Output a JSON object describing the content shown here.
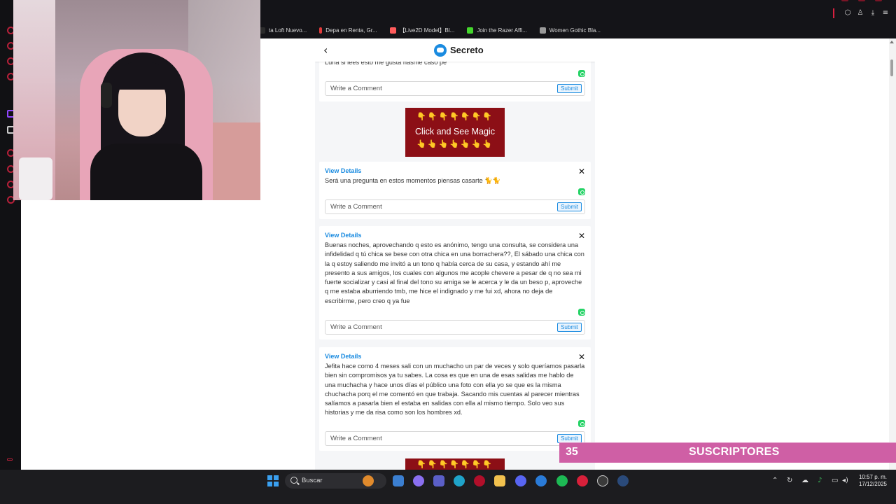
{
  "browser": {
    "bookmarks": [
      {
        "label": "ta Loft Nuevo...",
        "color": "#2b2b2b"
      },
      {
        "label": "Depa en Renta, Gr...",
        "color": "#e23b3b"
      },
      {
        "label": "【Live2D Model】Bl...",
        "color": "#ff5b5b"
      },
      {
        "label": "Join the Razer Affi...",
        "color": "#44d62c"
      },
      {
        "label": "Women Gothic Bla...",
        "color": "#9a9a9a"
      }
    ]
  },
  "page": {
    "title": "Secreto",
    "back_icon": "chevron-left-icon",
    "brand_color": "#1a8be0",
    "partial_top_message": "Luna si lees esto me gusta hasme caso pe",
    "comment_placeholder": "Write a Comment",
    "submit_label": "Submit",
    "ad": {
      "emoji_top": "👇👇👇👇👇👇👇",
      "text": "Click and See Magic",
      "emoji_bottom": "👆👆👆👆👆👆👆"
    },
    "posts": [
      {
        "view_details": "View Details",
        "close": "✕",
        "text": "Será una pregunta en estos momentos piensas casarte 🐈🐈"
      },
      {
        "view_details": "View Details",
        "close": "✕",
        "text": "Buenas noches, aprovechando q esto es anónimo, tengo una consulta, se considera una infidelidad q tú chica se bese con otra chica en una borrachera??, El sábado una chica con la q estoy saliendo me invitó a un tono q había cerca de su casa, y estando ahí me presento a sus amigos, los cuales con algunos me acople chevere a pesar de q no sea mi fuerte socializar y casi al final del tono su amiga se le acerca y le da un beso p, aproveche q me estaba aburriendo tmb, me hice el indignado y me fui xd, ahora no deja de escribirme, pero creo q ya fue"
      },
      {
        "view_details": "View Details",
        "close": "✕",
        "text": "Jefita hace como 4 meses sali con un muchacho un par de veces y solo queríamos pasarla bien sin compromisos ya tu sabes. La cosa es que en una de esas salidas me hablo de una muchacha y hace unos días el público una foto con ella yo se que es la misma chuchacha porq el me comentó en que trabaja. Sacando mis cuentas al parecer mientras salíamos a pasarla bien el estaba en salidas con ella al mismo tiempo. Solo veo sus historias y me da risa como son los hombres xd."
      }
    ]
  },
  "overlay": {
    "subs_count": "35",
    "subs_label": "SUSCRIPTORES",
    "banner_color": "#cf5fa5"
  },
  "taskbar": {
    "search_label": "Buscar",
    "time": "10:57 p. m.",
    "date": "17/12/2025"
  }
}
